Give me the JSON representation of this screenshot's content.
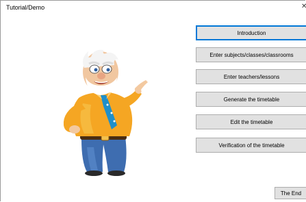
{
  "window": {
    "title": "Tutorial/Demo",
    "close_glyph": "✕",
    "close_icon": "close-icon"
  },
  "mascot": {
    "icon": "pointing-old-man-mascot"
  },
  "menu": {
    "buttons": [
      "Introduction",
      "Enter subjects/classes/classrooms",
      "Enter teachers/lessons",
      "Generate the timetable",
      "Edit the timetable",
      "Verification of the timetable"
    ],
    "focused_index": 0,
    "focus_color": "#0078d7"
  },
  "end_button": {
    "label": "The End"
  }
}
